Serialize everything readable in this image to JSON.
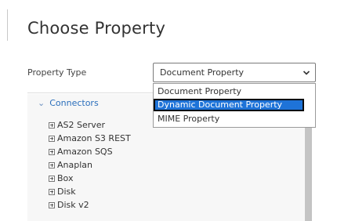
{
  "dialog": {
    "title": "Choose Property",
    "property_type_label": "Property Type",
    "select": {
      "value": "Document Property",
      "caret_icon": "chevron-down-icon"
    },
    "dropdown_options": [
      {
        "label": "Document Property",
        "selected": false
      },
      {
        "label": "Dynamic Document Property",
        "selected": true
      },
      {
        "label": "MIME Property",
        "selected": false
      }
    ],
    "tree": {
      "group_label": "Connectors",
      "group_icon": "chevron-down-icon",
      "item_icon": "expand-plus-icon",
      "items": [
        "AS2 Server",
        "Amazon S3 REST",
        "Amazon SQS",
        "Anaplan",
        "Box",
        "Disk",
        "Disk v2"
      ]
    },
    "colors": {
      "highlight": "#1e73d8",
      "link": "#2a6ebb"
    }
  }
}
